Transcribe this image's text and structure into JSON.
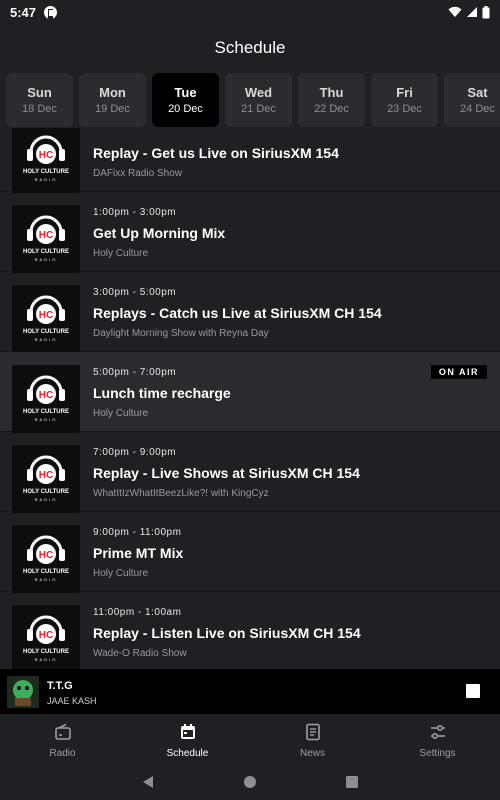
{
  "status_bar": {
    "time": "5:47"
  },
  "header": {
    "title": "Schedule"
  },
  "days": [
    {
      "name": "Sun",
      "date": "18 Dec",
      "active": false
    },
    {
      "name": "Mon",
      "date": "19 Dec",
      "active": false
    },
    {
      "name": "Tue",
      "date": "20 Dec",
      "active": true
    },
    {
      "name": "Wed",
      "date": "21 Dec",
      "active": false
    },
    {
      "name": "Thu",
      "date": "22 Dec",
      "active": false
    },
    {
      "name": "Fri",
      "date": "23 Dec",
      "active": false
    },
    {
      "name": "Sat",
      "date": "24 Dec",
      "active": false
    }
  ],
  "shows": [
    {
      "time": "",
      "title": "Replay - Get us Live on SiriusXM 154",
      "host": "DAFixx Radio Show",
      "on_air": false
    },
    {
      "time": "1:00pm - 3:00pm",
      "title": "Get Up Morning Mix",
      "host": "Holy Culture",
      "on_air": false
    },
    {
      "time": "3:00pm - 5:00pm",
      "title": "Replays - Catch us Live at SiriusXM CH 154",
      "host": "Daylight Morning Show with Reyna Day",
      "on_air": false
    },
    {
      "time": "5:00pm - 7:00pm",
      "title": "Lunch time recharge",
      "host": "Holy Culture",
      "on_air": true
    },
    {
      "time": "7:00pm - 9:00pm",
      "title": "Replay - Live Shows at SiriusXM CH 154",
      "host": "WhatItIzWhatItBeezLike?! with KingCyz",
      "on_air": false
    },
    {
      "time": "9:00pm - 11:00pm",
      "title": "Prime MT Mix",
      "host": "Holy Culture",
      "on_air": false
    },
    {
      "time": "11:00pm - 1:00am",
      "title": "Replay - Listen Live on SiriusXM CH 154",
      "host": "Wade-O Radio Show",
      "on_air": false
    }
  ],
  "logo": {
    "line1": "HOLY CULTURE",
    "line2": "RADIO",
    "monogram": "HC"
  },
  "on_air_label": "ON AIR",
  "mini_player": {
    "title": "T.T.G",
    "artist": "JAAE KASH"
  },
  "bottom_nav": [
    {
      "label": "Radio",
      "icon": "radio-icon",
      "active": false
    },
    {
      "label": "Schedule",
      "icon": "calendar-icon",
      "active": true
    },
    {
      "label": "News",
      "icon": "news-icon",
      "active": false
    },
    {
      "label": "Settings",
      "icon": "sliders-icon",
      "active": false
    }
  ],
  "colors": {
    "background": "#1f2023",
    "tab": "#2b2c30",
    "active_tab": "#000000",
    "on_air_row": "#2a2b2f",
    "logo_red": "#e5232b"
  }
}
